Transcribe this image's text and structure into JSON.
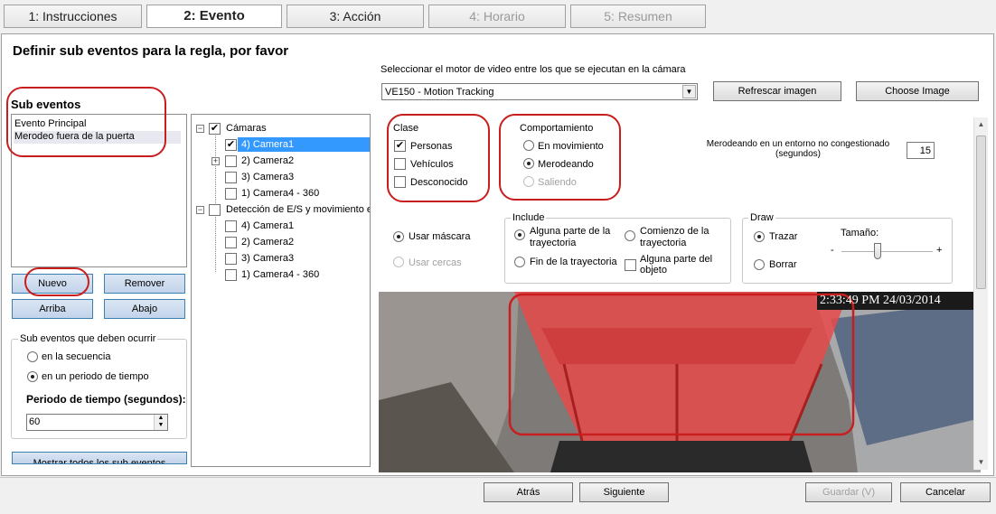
{
  "tabs": [
    {
      "label": "1: Instrucciones"
    },
    {
      "label": "2: Evento"
    },
    {
      "label": "3: Acción"
    },
    {
      "label": "4: Horario"
    },
    {
      "label": "5: Resumen"
    }
  ],
  "heading": "Definir sub eventos para la regla, por favor",
  "sub_events": {
    "title": "Sub eventos",
    "items": [
      "Evento Principal",
      "Merodeo fuera de la puerta"
    ],
    "buttons": {
      "new": "Nuevo",
      "remove": "Remover",
      "up": "Arriba",
      "down": "Abajo"
    }
  },
  "occurrence": {
    "title": "Sub eventos que deben ocurrir",
    "option_sequence": "en la secuencia",
    "option_period": "en un periodo de tiempo",
    "period_label": "Periodo de tiempo (segundos):",
    "period_value": "60",
    "show_all_button": "Mostrar todos los sub eventos"
  },
  "tree": {
    "root1": "Cámaras",
    "cams1": [
      "4) Camera1",
      "2) Camera2",
      "3) Camera3",
      "1) Camera4 - 360"
    ],
    "root2": "Detección de E/S y movimiento en",
    "cams2": [
      "4) Camera1",
      "2) Camera2",
      "3) Camera3",
      "1) Camera4 - 360"
    ]
  },
  "engine": {
    "label": "Seleccionar el motor de video entre los que se ejecutan en la cámara",
    "selected": "VE150 - Motion Tracking",
    "refresh_button": "Refrescar imagen",
    "choose_button": "Choose Image"
  },
  "clase": {
    "title": "Clase",
    "options": [
      "Personas",
      "Vehículos",
      "Desconocido"
    ]
  },
  "comportamiento": {
    "title": "Comportamiento",
    "options": [
      "En movimiento",
      "Merodeando",
      "Saliendo"
    ]
  },
  "loiter": {
    "label_line1": "Merodeando en un entorno no congestionado",
    "label_line2": "(segundos)",
    "value": "15"
  },
  "mask": {
    "use_mask": "Usar máscara",
    "use_fences": "Usar cercas"
  },
  "include": {
    "title": "Include",
    "opt1": "Alguna parte de la trayectoria",
    "opt2": "Comienzo de la trayectoria",
    "opt3": "Fin de la trayectoria",
    "opt4": "Alguna parte del objeto"
  },
  "draw": {
    "title": "Draw",
    "trace": "Trazar",
    "erase": "Borrar",
    "size_label": "Tamaño:",
    "minus": "-",
    "plus": "+",
    "size_level": 0.4
  },
  "video": {
    "timestamp": "2:33:49 PM 24/03/2014"
  },
  "footer": {
    "back": "Atrás",
    "next": "Siguiente",
    "save": "Guardar (V)",
    "cancel": "Cancelar"
  },
  "colors": {
    "annotation": "#c81e1e",
    "selection": "#3399ff",
    "overlay": "#e84a4a"
  }
}
